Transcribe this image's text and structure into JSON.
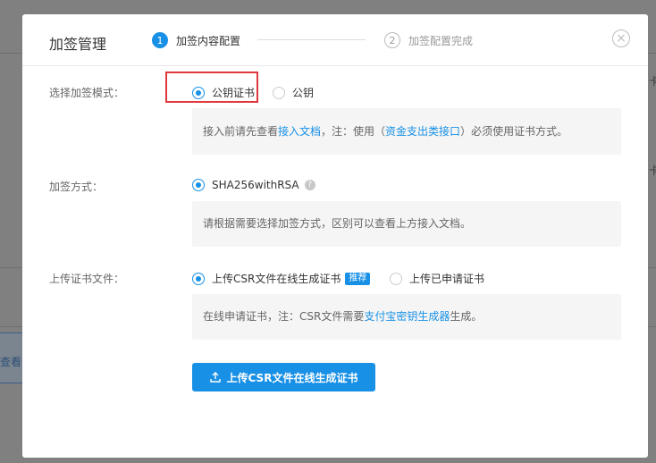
{
  "background": {
    "right_text_1": "卡",
    "right_text_2": "卡",
    "left_link_text": "查看以"
  },
  "modal": {
    "title": "加签管理",
    "steps": [
      {
        "number": "1",
        "label": "加签内容配置",
        "state": "active"
      },
      {
        "number": "2",
        "label": "加签配置完成",
        "state": "inactive"
      }
    ],
    "close_symbol": "×"
  },
  "mode": {
    "label": "选择加签模式：",
    "options": [
      {
        "label": "公钥证书",
        "checked": true
      },
      {
        "label": "公钥",
        "checked": false
      }
    ],
    "info_prefix": "接入前请先查看",
    "info_link1": "接入文档",
    "info_mid": "，注：使用（",
    "info_link2": "资金支出类接口",
    "info_suffix": "）必须使用证书方式。"
  },
  "method": {
    "label": "加签方式：",
    "option": "SHA256withRSA",
    "help_symbol": "?",
    "info": "请根据需要选择加签方式，区别可以查看上方接入文档。"
  },
  "upload": {
    "label": "上传证书文件：",
    "options": [
      {
        "label": "上传CSR文件在线生成证书",
        "checked": true,
        "badge": "推荐"
      },
      {
        "label": "上传已申请证书",
        "checked": false
      }
    ],
    "info_prefix": "在线申请证书，注：CSR文件需要",
    "info_link": "支付宝密钥生成器",
    "info_suffix": "生成。",
    "button_label": "上传CSR文件在线生成证书"
  },
  "colors": {
    "accent": "#1890e6",
    "highlight": "#e0383e",
    "info_bg": "#f5f5f5"
  }
}
